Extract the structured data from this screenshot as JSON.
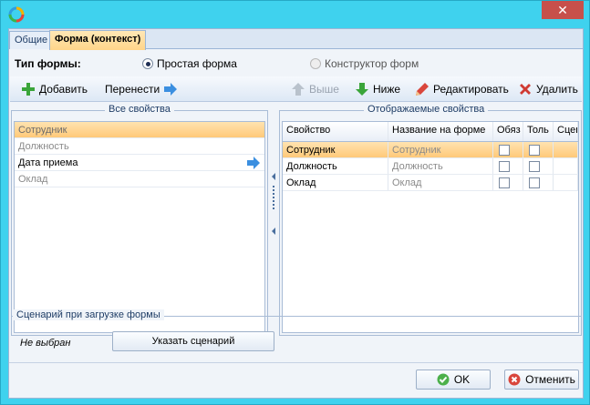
{
  "window": {
    "close_glyph": "✕"
  },
  "tabs": [
    {
      "label": "Общие",
      "active": false
    },
    {
      "label": "Форма (контекст)",
      "active": true
    }
  ],
  "form_type": {
    "label": "Тип формы:",
    "options": [
      {
        "label": "Простая форма",
        "selected": true,
        "enabled": true
      },
      {
        "label": "Конструктор форм",
        "selected": false,
        "enabled": false
      }
    ]
  },
  "toolbar": {
    "add": {
      "label": "Добавить",
      "icon": "plus-icon",
      "enabled": true
    },
    "move": {
      "label": "Перенести",
      "icon": "arrow-right-icon",
      "enabled": true
    },
    "up": {
      "label": "Выше",
      "icon": "arrow-up-icon",
      "enabled": false
    },
    "down": {
      "label": "Ниже",
      "icon": "arrow-down-icon",
      "enabled": true
    },
    "edit": {
      "label": "Редактировать",
      "icon": "pencil-icon",
      "enabled": true
    },
    "delete": {
      "label": "Удалить",
      "icon": "x-icon",
      "enabled": true
    }
  },
  "all_properties": {
    "title": "Все свойства",
    "items": [
      {
        "label": "Сотрудник",
        "state": "selected"
      },
      {
        "label": "Должность",
        "state": "grey"
      },
      {
        "label": "Дата приема",
        "state": "normal"
      },
      {
        "label": "Оклад",
        "state": "grey"
      }
    ]
  },
  "displayed_properties": {
    "title": "Отображаемые свойства",
    "columns": [
      "Свойство",
      "Название на форме",
      "Обяз",
      "Толь",
      "Сцен"
    ],
    "rows": [
      {
        "property": "Сотрудник",
        "form_name": "Сотрудник",
        "required": false,
        "readonly": false,
        "selected": true
      },
      {
        "property": "Должность",
        "form_name": "Должность",
        "required": false,
        "readonly": false,
        "selected": false
      },
      {
        "property": "Оклад",
        "form_name": "Оклад",
        "required": false,
        "readonly": false,
        "selected": false
      }
    ]
  },
  "load_scenario": {
    "title": "Сценарий при загрузке формы",
    "value": "Не выбран",
    "button_label": "Указать сценарий"
  },
  "footer": {
    "ok_label": "OK",
    "cancel_label": "Отменить"
  },
  "colors": {
    "window_frame": "#3fd2ee",
    "selection": "#ffc979",
    "close_button": "#c7504b"
  }
}
